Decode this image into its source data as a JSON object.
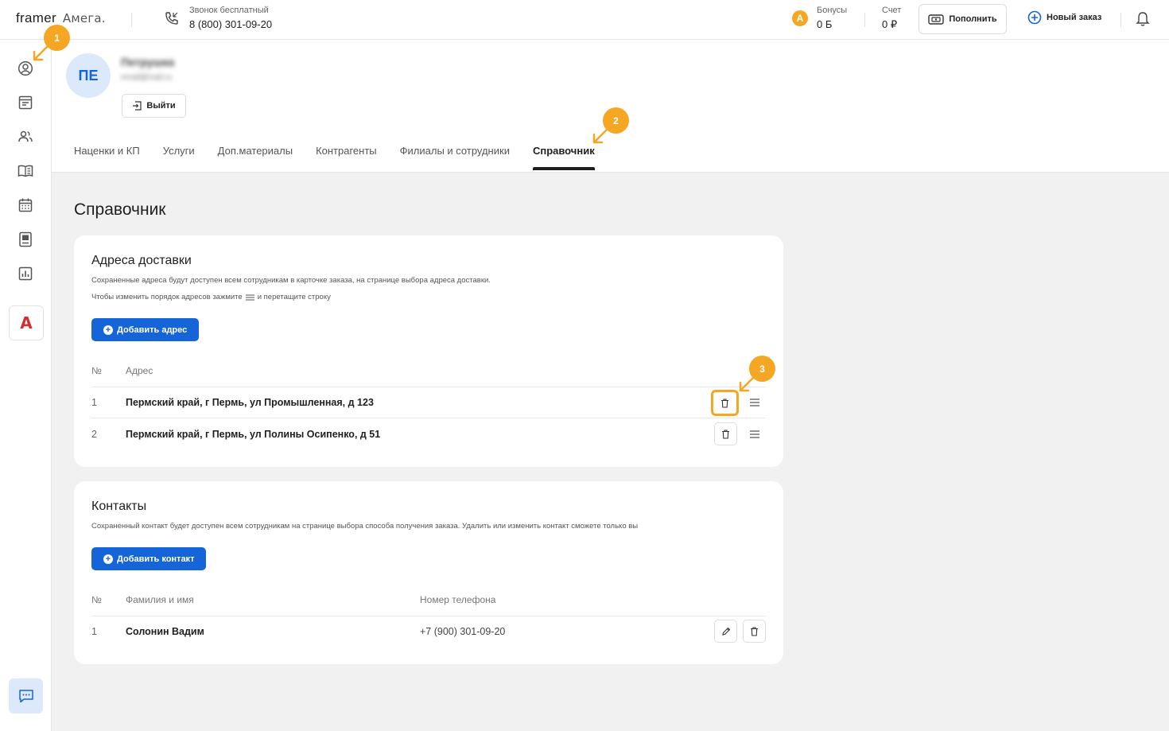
{
  "header": {
    "logo_framer": "framer",
    "logo_amega": "Амега.",
    "phone_caption": "Звонок бесплатный",
    "phone_number": "8 (800) 301-09-20",
    "bonus_icon_letter": "A",
    "bonus_label": "Бонусы",
    "bonus_value": "0 Б",
    "account_label": "Счет",
    "account_value": "0 ₽",
    "topup_label": "Пополнить",
    "new_order_label": "Новый заказ"
  },
  "sidebar": {
    "items": [
      "profile-icon",
      "orders-icon",
      "clients-icon",
      "catalog-icon",
      "calendar-icon",
      "gallery-icon",
      "reports-icon"
    ],
    "brand_letter": "A"
  },
  "profile": {
    "avatar_initials": "ПЕ",
    "name": "Петрушка",
    "email": "email@mail.ru",
    "logout_label": "Выйти"
  },
  "tabs": [
    {
      "label": "Наценки и КП"
    },
    {
      "label": "Услуги"
    },
    {
      "label": "Доп.материалы"
    },
    {
      "label": "Контрагенты"
    },
    {
      "label": "Филиалы и сотрудники"
    },
    {
      "label": "Справочник",
      "active": true
    }
  ],
  "page_title": "Справочник",
  "addresses": {
    "title": "Адреса доставки",
    "note1": "Сохраненные адреса будут доступен всем сотрудникам в карточке заказа, на странице выбора адреса доставки.",
    "note2_before": "Чтобы изменить порядок адресов зажмите",
    "note2_after": "и перетащите строку",
    "add_button": "Добавить адрес",
    "columns": {
      "num": "№",
      "address": "Адрес"
    },
    "rows": [
      {
        "num": "1",
        "address": "Пермский край, г Пермь, ул Промышленная, д 123"
      },
      {
        "num": "2",
        "address": "Пермский край, г Пермь, ул Полины Осипенко, д 51"
      }
    ]
  },
  "contacts": {
    "title": "Контакты",
    "note": "Сохраненный контакт будет доступен всем сотрудникам на странице выбора способа получения заказа. Удалить или изменить контакт сможете только вы",
    "add_button": "Добавить контакт",
    "columns": {
      "num": "№",
      "name": "Фамилия и имя",
      "phone": "Номер телефона"
    },
    "rows": [
      {
        "num": "1",
        "name": "Солонин Вадим",
        "phone": "+7 (900) 301-09-20"
      }
    ]
  },
  "annotations": [
    "1",
    "2",
    "3"
  ],
  "colors": {
    "accent": "#1565d8",
    "annotation": "#f5a623",
    "brand_red": "#d32f2f"
  }
}
